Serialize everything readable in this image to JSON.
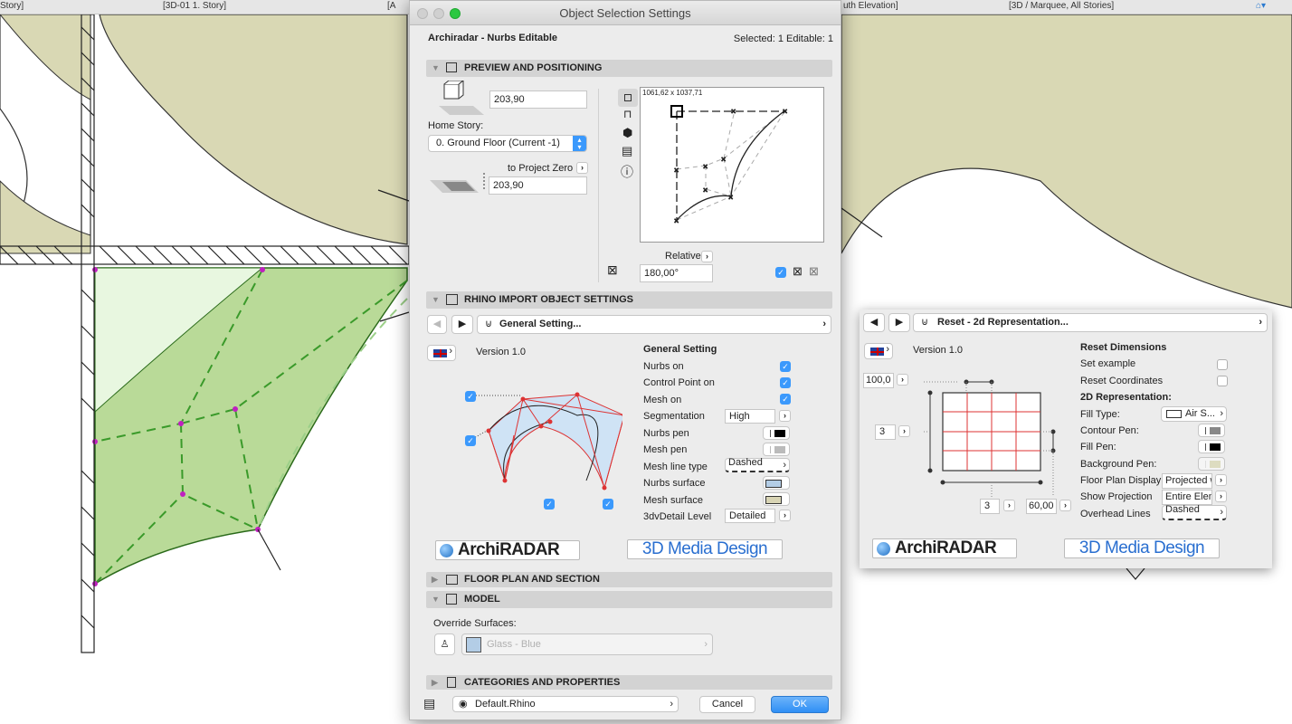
{
  "tabs": [
    "Story]",
    "[3D-01 1. Story]",
    "[A",
    "uth Elevation]",
    "[3D / Marquee, All Stories]"
  ],
  "dialog": {
    "title": "Object Selection Settings",
    "object_name": "Archiradar - Nurbs Editable",
    "selection_info": "Selected: 1 Editable: 1",
    "sections": {
      "preview": "PREVIEW AND POSITIONING",
      "rhino": "RHINO IMPORT OBJECT SETTINGS",
      "floor_plan": "FLOOR PLAN AND SECTION",
      "model": "MODEL",
      "categories": "CATEGORIES AND PROPERTIES"
    },
    "preview": {
      "elevation": "203,90",
      "home_story_label": "Home Story:",
      "home_story_value": "0. Ground Floor (Current -1)",
      "to_project_zero_label": "to Project Zero",
      "project_zero_value": "203,90",
      "dimensions": "1061,62 x 1037,71",
      "relative_label": "Relative",
      "rotation": "180,00°",
      "mirror_checked": true
    },
    "rhino": {
      "page_select": "General Setting...",
      "version": "Version 1.0",
      "group_title": "General Setting",
      "rows": [
        {
          "label": "Nurbs on",
          "type": "checkbox",
          "checked": true
        },
        {
          "label": "Control Point on",
          "type": "checkbox",
          "checked": true
        },
        {
          "label": "Mesh on",
          "type": "checkbox",
          "checked": true
        },
        {
          "label": "Segmentation",
          "type": "select",
          "value": "High"
        },
        {
          "label": "Nurbs pen",
          "type": "pen",
          "color": "#000000"
        },
        {
          "label": "Mesh pen",
          "type": "pen",
          "color": "#bbbbbb"
        },
        {
          "label": "Mesh line type",
          "type": "linetype",
          "value": "Dashed"
        },
        {
          "label": "Nurbs surface",
          "type": "surface",
          "color": "#b3cde6"
        },
        {
          "label": "Mesh surface",
          "type": "surface",
          "color": "#d8d4b4"
        },
        {
          "label": "3dvDetail Level",
          "type": "select",
          "value": "Detailed"
        }
      ],
      "logo_archiradar": "ArchiRADAR",
      "logo_3dmedia": "3D Media Design"
    },
    "model": {
      "override_label": "Override Surfaces:",
      "surface_value": "Glass - Blue",
      "surface_color": "#b3cde6"
    },
    "footer": {
      "layer": "Default.Rhino",
      "cancel": "Cancel",
      "ok": "OK"
    },
    "accent": "#3b99fc"
  },
  "panel": {
    "page_select": "Reset - 2d Representation...",
    "version": "Version 1.0",
    "inputs": {
      "top": "100,0",
      "left": "3",
      "bottom": "3",
      "right": "60,00"
    },
    "reset_title": "Reset Dimensions",
    "set_example": "Set example",
    "reset_coordinates": "Reset Coordinates",
    "rep_title": "2D Representation:",
    "fill_type_label": "Fill Type:",
    "fill_type_value": "Air S...",
    "contour_pen_label": "Contour Pen:",
    "fill_pen_label": "Fill Pen:",
    "background_pen_label": "Background Pen:",
    "floor_plan_display_label": "Floor Plan Display",
    "floor_plan_display_value": "Projected w",
    "show_projection_label": "Show Projection",
    "show_projection_value": "Entire Elem",
    "overhead_lines_label": "Overhead Lines",
    "overhead_lines_value": "Dashed",
    "logo_archiradar": "ArchiRADAR",
    "logo_3dmedia": "3D Media Design"
  }
}
